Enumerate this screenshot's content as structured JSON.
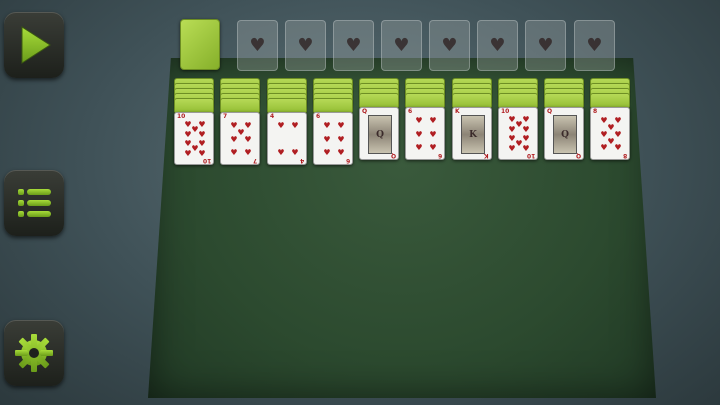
{
  "menu": {
    "play_icon": "play-icon",
    "menu_icon": "list-icon",
    "settings_icon": "gear-icon",
    "accent_color": "#8bc12a"
  },
  "stock": {
    "icon": "card-back"
  },
  "foundation": {
    "slots": 8,
    "suit": "♥"
  },
  "tableau": {
    "columns": [
      {
        "hidden": 5,
        "rank": "10",
        "suit": "♥",
        "face": false
      },
      {
        "hidden": 5,
        "rank": "7",
        "suit": "♥",
        "face": false
      },
      {
        "hidden": 5,
        "rank": "4",
        "suit": "♥",
        "face": false
      },
      {
        "hidden": 5,
        "rank": "6",
        "suit": "♥",
        "face": false
      },
      {
        "hidden": 4,
        "rank": "Q",
        "suit": "♥",
        "face": true
      },
      {
        "hidden": 4,
        "rank": "6",
        "suit": "♥",
        "face": false
      },
      {
        "hidden": 4,
        "rank": "K",
        "suit": "♥",
        "face": true
      },
      {
        "hidden": 4,
        "rank": "10",
        "suit": "♥",
        "face": false
      },
      {
        "hidden": 4,
        "rank": "Q",
        "suit": "♥",
        "face": true
      },
      {
        "hidden": 4,
        "rank": "8",
        "suit": "♥",
        "face": false
      }
    ]
  }
}
